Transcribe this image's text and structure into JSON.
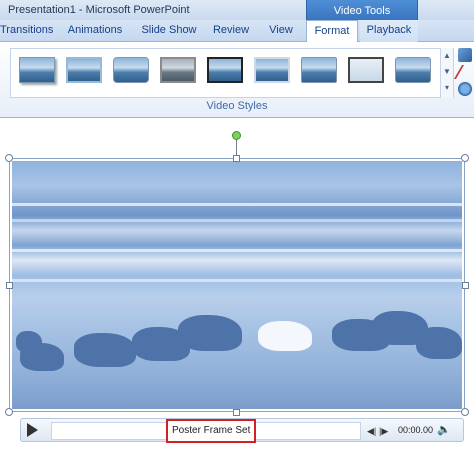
{
  "window": {
    "title": "Presentation1 - Microsoft PowerPoint",
    "context_tab_group": "Video Tools"
  },
  "tabs": [
    {
      "label": "Transitions",
      "active": false
    },
    {
      "label": "Animations",
      "active": false
    },
    {
      "label": "Slide Show",
      "active": false
    },
    {
      "label": "Review",
      "active": false
    },
    {
      "label": "View",
      "active": false
    },
    {
      "label": "Format",
      "active": true
    },
    {
      "label": "Playback",
      "active": false
    }
  ],
  "ribbon": {
    "group_label": "Video Styles",
    "style_thumbnails": [
      "style-1",
      "style-2",
      "style-3",
      "style-4",
      "style-5",
      "style-6",
      "style-7",
      "style-8",
      "style-9"
    ],
    "scroll_up": "▲",
    "scroll_down": "▼",
    "more": "▾"
  },
  "player": {
    "poster_status": "Poster Frame Set",
    "time": "00:00.00",
    "back_glyph": "◀|",
    "fwd_glyph": "|▶",
    "volume_glyph": "🔈"
  },
  "colors": {
    "context_tab": "#3a75c0",
    "highlight_border": "#d42020",
    "rotation_handle": "#7fd05a"
  }
}
